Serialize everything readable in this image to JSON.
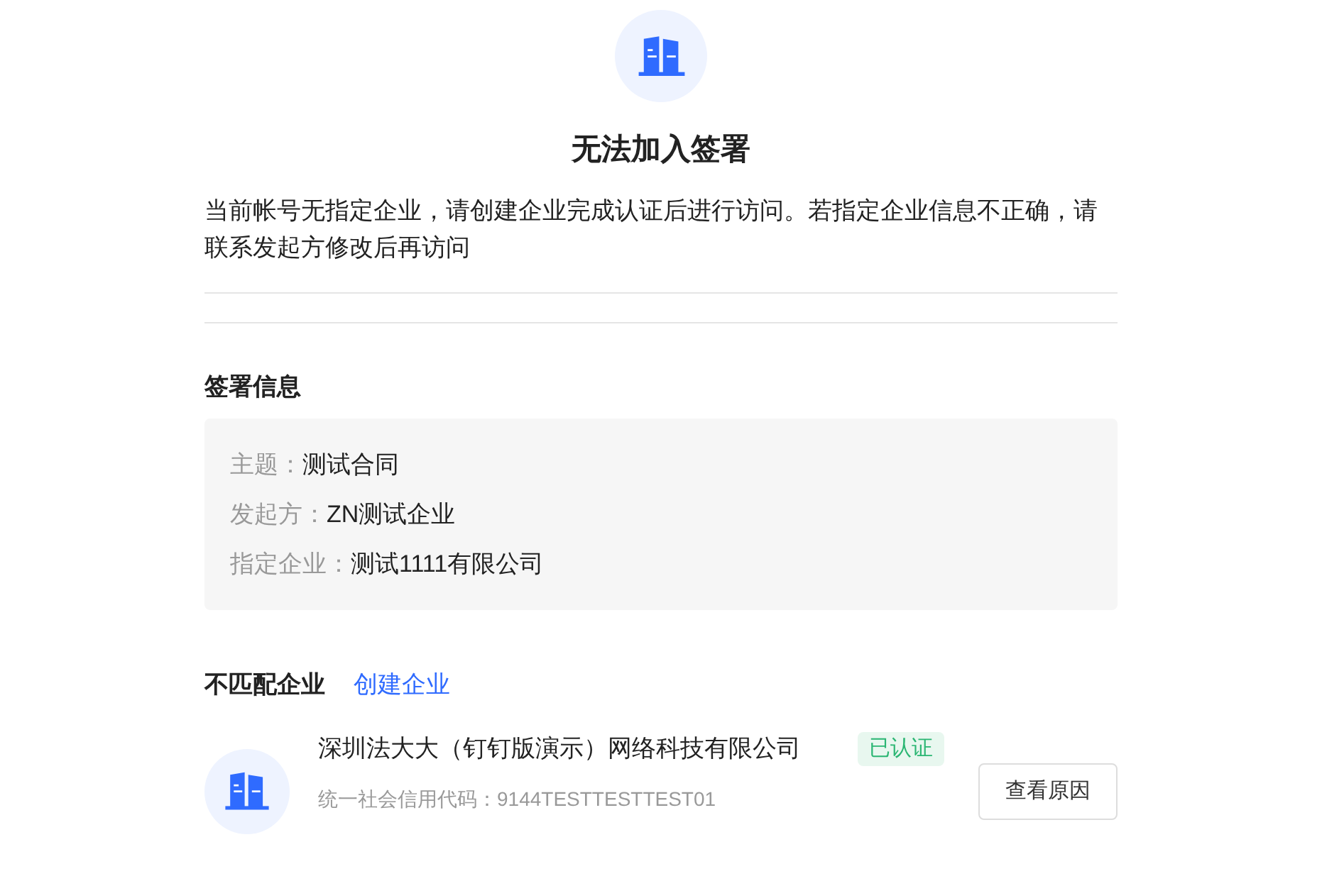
{
  "title": "无法加入签署",
  "message": "当前帐号无指定企业，请创建企业完成认证后进行访问。若指定企业信息不正确，请联系发起方修改后再访问",
  "sign_info": {
    "heading": "签署信息",
    "fields": [
      {
        "label": "主题：",
        "value": "测试合同"
      },
      {
        "label": "发起方：",
        "value": "ZN测试企业"
      },
      {
        "label": "指定企业：",
        "value": "测试1111有限公司"
      }
    ]
  },
  "mismatch": {
    "heading": "不匹配企业",
    "link": "创建企业",
    "companies": [
      {
        "name": "深圳法大大（钉钉版演示）网络科技有限公司",
        "badge": "已认证",
        "code": "统一社会信用代码：9144TESTTESTTEST01",
        "button": "查看原因"
      }
    ]
  }
}
